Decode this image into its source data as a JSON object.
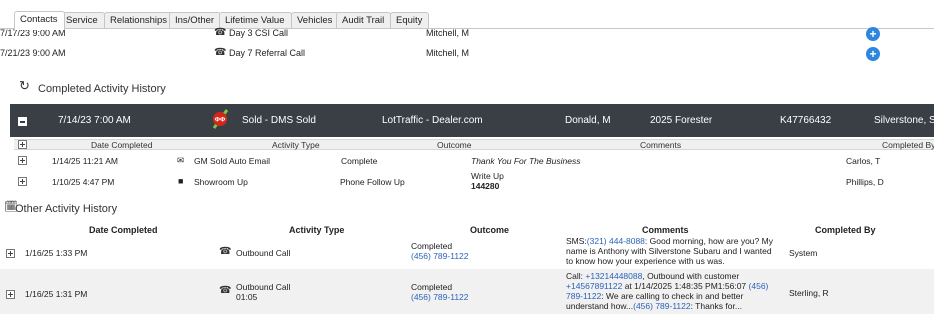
{
  "tabs": [
    {
      "label": "Contacts",
      "active": true
    },
    {
      "label": "Service",
      "active": false
    },
    {
      "label": "Relationships",
      "active": false
    },
    {
      "label": "Ins/Other",
      "active": false
    },
    {
      "label": "Lifetime Value",
      "active": false
    },
    {
      "label": "Vehicles",
      "active": false
    },
    {
      "label": "Audit Trail",
      "active": false
    },
    {
      "label": "Equity",
      "active": false
    }
  ],
  "upcoming": [
    {
      "date": "7/17/23 9:00 AM",
      "activity": "Day 3 CSI Call",
      "assigned": "Mitchell, M"
    },
    {
      "date": "7/21/23 9:00 AM",
      "activity": "Day 7 Referral Call",
      "assigned": "Mitchell, M"
    }
  ],
  "completed_history": {
    "title": "Completed Activity History",
    "deal": {
      "date": "7/14/23 7:00 AM",
      "sold_badge": "ΦΦ",
      "status": "Sold - DMS Sold",
      "source": "LotTraffic - Dealer.com",
      "salesperson": "Donald, M",
      "vehicle": "2025 Forester",
      "stock": "K47766432",
      "dealer": "Silverstone, S"
    },
    "headers": {
      "date": "Date Completed",
      "type": "Activity Type",
      "outcome": "Outcome",
      "comments": "Comments",
      "by": "Completed By"
    },
    "rows": [
      {
        "date": "1/14/25 11:21 AM",
        "icon": "email-icon",
        "type": "GM Sold Auto Email",
        "outcome": "Complete",
        "comment1": "Thank You For The Business",
        "comment2": "",
        "by": "Carlos, T"
      },
      {
        "date": "1/10/25 4:47 PM",
        "icon": "showroom-icon",
        "type": "Showroom Up",
        "outcome": "Phone Follow Up",
        "comment1": "Write Up",
        "comment2": "144280",
        "by": "Phillips, D"
      }
    ]
  },
  "other_history": {
    "title": "Other Activity History",
    "headers": {
      "date": "Date Completed",
      "type": "Activity Type",
      "outcome": "Outcome",
      "comments": "Comments",
      "by": "Completed By"
    },
    "rows": [
      {
        "date": "1/16/25 1:33 PM",
        "type": "Outbound Call",
        "duration": "",
        "outcome": "Completed",
        "phone": "(456) 789-1122",
        "comment": {
          "p1": "SMS:",
          "l1": "(321) 444-8088",
          "p2": ": Good morning, how are you? My name is Anthony with Silverstone Subaru and I wanted to know how your experience with us was.",
          "l2": "",
          "p3": "",
          "l3": "",
          "p4": "",
          "l4": "",
          "p5": ""
        },
        "by": "System"
      },
      {
        "date": "1/16/25 1:31 PM",
        "type": "Outbound Call",
        "duration": "01:05",
        "outcome": "Completed",
        "phone": "(456) 789-1122",
        "comment": {
          "p1": "Call: ",
          "l1": "+13214448088",
          "p2": ", Outbound with customer ",
          "l2": "+14567891122",
          "p3": " at 1/14/2025 1:48:35 PM1:56:07 ",
          "l3": "(456) 789-1122",
          "p4": ": We are calling to check in and better understand how...",
          "l4": "(456) 789-1122",
          "p5": ": Thanks for..."
        },
        "by": "Sterling, R"
      }
    ]
  },
  "colors": {
    "dark_bar": "#3a3f46",
    "accent_blue": "#2e86de",
    "link_blue": "#2a63b8",
    "shaded_row": "#f1f1f1"
  }
}
